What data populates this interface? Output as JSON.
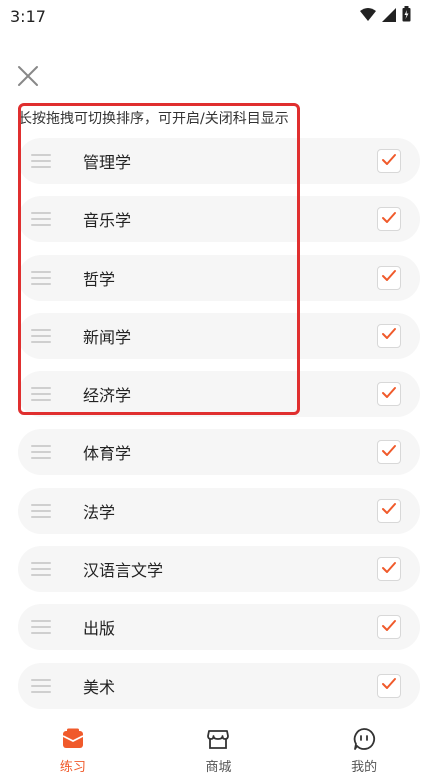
{
  "status": {
    "time": "3:17"
  },
  "hint_text": "长按拖拽可切换排序，可开启/关闭科目显示",
  "subjects": [
    {
      "label": "管理学",
      "checked": true
    },
    {
      "label": "音乐学",
      "checked": true
    },
    {
      "label": "哲学",
      "checked": true
    },
    {
      "label": "新闻学",
      "checked": true
    },
    {
      "label": "经济学",
      "checked": true
    },
    {
      "label": "体育学",
      "checked": true
    },
    {
      "label": "法学",
      "checked": true
    },
    {
      "label": "汉语言文学",
      "checked": true
    },
    {
      "label": "出版",
      "checked": true
    },
    {
      "label": "美术",
      "checked": true
    }
  ],
  "tabs": [
    {
      "label": "练习",
      "icon": "practice-icon",
      "active": true
    },
    {
      "label": "商城",
      "icon": "store-icon",
      "active": false
    },
    {
      "label": "我的",
      "icon": "profile-icon",
      "active": false
    }
  ],
  "colors": {
    "accent": "#f05a2b",
    "highlight": "#e02f2f",
    "row_bg": "#f6f6f6"
  }
}
